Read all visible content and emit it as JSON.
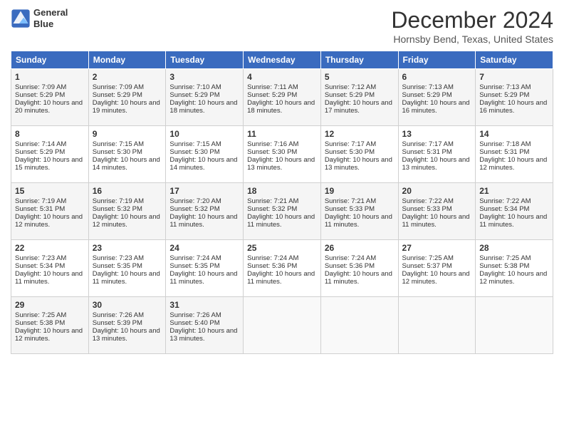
{
  "header": {
    "logo_line1": "General",
    "logo_line2": "Blue",
    "title": "December 2024",
    "location": "Hornsby Bend, Texas, United States"
  },
  "days_of_week": [
    "Sunday",
    "Monday",
    "Tuesday",
    "Wednesday",
    "Thursday",
    "Friday",
    "Saturday"
  ],
  "weeks": [
    [
      {
        "num": "1",
        "rise": "Sunrise: 7:09 AM",
        "set": "Sunset: 5:29 PM",
        "daylight": "Daylight: 10 hours and 20 minutes."
      },
      {
        "num": "2",
        "rise": "Sunrise: 7:09 AM",
        "set": "Sunset: 5:29 PM",
        "daylight": "Daylight: 10 hours and 19 minutes."
      },
      {
        "num": "3",
        "rise": "Sunrise: 7:10 AM",
        "set": "Sunset: 5:29 PM",
        "daylight": "Daylight: 10 hours and 18 minutes."
      },
      {
        "num": "4",
        "rise": "Sunrise: 7:11 AM",
        "set": "Sunset: 5:29 PM",
        "daylight": "Daylight: 10 hours and 18 minutes."
      },
      {
        "num": "5",
        "rise": "Sunrise: 7:12 AM",
        "set": "Sunset: 5:29 PM",
        "daylight": "Daylight: 10 hours and 17 minutes."
      },
      {
        "num": "6",
        "rise": "Sunrise: 7:13 AM",
        "set": "Sunset: 5:29 PM",
        "daylight": "Daylight: 10 hours and 16 minutes."
      },
      {
        "num": "7",
        "rise": "Sunrise: 7:13 AM",
        "set": "Sunset: 5:29 PM",
        "daylight": "Daylight: 10 hours and 16 minutes."
      }
    ],
    [
      {
        "num": "8",
        "rise": "Sunrise: 7:14 AM",
        "set": "Sunset: 5:29 PM",
        "daylight": "Daylight: 10 hours and 15 minutes."
      },
      {
        "num": "9",
        "rise": "Sunrise: 7:15 AM",
        "set": "Sunset: 5:30 PM",
        "daylight": "Daylight: 10 hours and 14 minutes."
      },
      {
        "num": "10",
        "rise": "Sunrise: 7:15 AM",
        "set": "Sunset: 5:30 PM",
        "daylight": "Daylight: 10 hours and 14 minutes."
      },
      {
        "num": "11",
        "rise": "Sunrise: 7:16 AM",
        "set": "Sunset: 5:30 PM",
        "daylight": "Daylight: 10 hours and 13 minutes."
      },
      {
        "num": "12",
        "rise": "Sunrise: 7:17 AM",
        "set": "Sunset: 5:30 PM",
        "daylight": "Daylight: 10 hours and 13 minutes."
      },
      {
        "num": "13",
        "rise": "Sunrise: 7:17 AM",
        "set": "Sunset: 5:31 PM",
        "daylight": "Daylight: 10 hours and 13 minutes."
      },
      {
        "num": "14",
        "rise": "Sunrise: 7:18 AM",
        "set": "Sunset: 5:31 PM",
        "daylight": "Daylight: 10 hours and 12 minutes."
      }
    ],
    [
      {
        "num": "15",
        "rise": "Sunrise: 7:19 AM",
        "set": "Sunset: 5:31 PM",
        "daylight": "Daylight: 10 hours and 12 minutes."
      },
      {
        "num": "16",
        "rise": "Sunrise: 7:19 AM",
        "set": "Sunset: 5:32 PM",
        "daylight": "Daylight: 10 hours and 12 minutes."
      },
      {
        "num": "17",
        "rise": "Sunrise: 7:20 AM",
        "set": "Sunset: 5:32 PM",
        "daylight": "Daylight: 10 hours and 11 minutes."
      },
      {
        "num": "18",
        "rise": "Sunrise: 7:21 AM",
        "set": "Sunset: 5:32 PM",
        "daylight": "Daylight: 10 hours and 11 minutes."
      },
      {
        "num": "19",
        "rise": "Sunrise: 7:21 AM",
        "set": "Sunset: 5:33 PM",
        "daylight": "Daylight: 10 hours and 11 minutes."
      },
      {
        "num": "20",
        "rise": "Sunrise: 7:22 AM",
        "set": "Sunset: 5:33 PM",
        "daylight": "Daylight: 10 hours and 11 minutes."
      },
      {
        "num": "21",
        "rise": "Sunrise: 7:22 AM",
        "set": "Sunset: 5:34 PM",
        "daylight": "Daylight: 10 hours and 11 minutes."
      }
    ],
    [
      {
        "num": "22",
        "rise": "Sunrise: 7:23 AM",
        "set": "Sunset: 5:34 PM",
        "daylight": "Daylight: 10 hours and 11 minutes."
      },
      {
        "num": "23",
        "rise": "Sunrise: 7:23 AM",
        "set": "Sunset: 5:35 PM",
        "daylight": "Daylight: 10 hours and 11 minutes."
      },
      {
        "num": "24",
        "rise": "Sunrise: 7:24 AM",
        "set": "Sunset: 5:35 PM",
        "daylight": "Daylight: 10 hours and 11 minutes."
      },
      {
        "num": "25",
        "rise": "Sunrise: 7:24 AM",
        "set": "Sunset: 5:36 PM",
        "daylight": "Daylight: 10 hours and 11 minutes."
      },
      {
        "num": "26",
        "rise": "Sunrise: 7:24 AM",
        "set": "Sunset: 5:36 PM",
        "daylight": "Daylight: 10 hours and 11 minutes."
      },
      {
        "num": "27",
        "rise": "Sunrise: 7:25 AM",
        "set": "Sunset: 5:37 PM",
        "daylight": "Daylight: 10 hours and 12 minutes."
      },
      {
        "num": "28",
        "rise": "Sunrise: 7:25 AM",
        "set": "Sunset: 5:38 PM",
        "daylight": "Daylight: 10 hours and 12 minutes."
      }
    ],
    [
      {
        "num": "29",
        "rise": "Sunrise: 7:25 AM",
        "set": "Sunset: 5:38 PM",
        "daylight": "Daylight: 10 hours and 12 minutes."
      },
      {
        "num": "30",
        "rise": "Sunrise: 7:26 AM",
        "set": "Sunset: 5:39 PM",
        "daylight": "Daylight: 10 hours and 13 minutes."
      },
      {
        "num": "31",
        "rise": "Sunrise: 7:26 AM",
        "set": "Sunset: 5:40 PM",
        "daylight": "Daylight: 10 hours and 13 minutes."
      },
      null,
      null,
      null,
      null
    ]
  ]
}
